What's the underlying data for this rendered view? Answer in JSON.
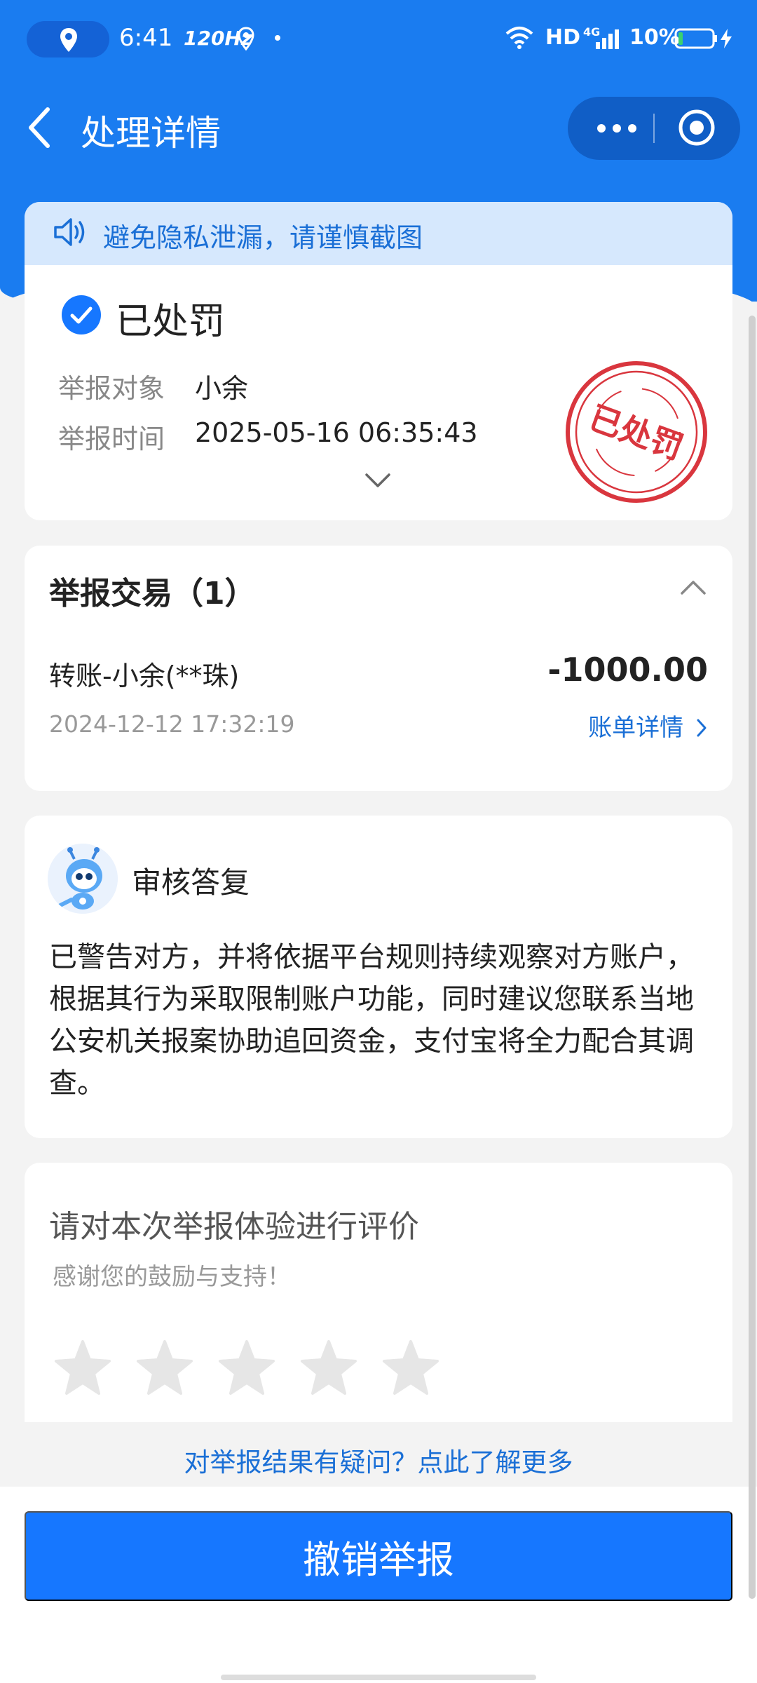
{
  "status_bar": {
    "time": "6:41",
    "refresh_rate": "120Hz",
    "hd": "HD",
    "network": "4G",
    "battery": "10%"
  },
  "nav": {
    "title": "处理详情"
  },
  "privacy_banner": {
    "text": "避免隐私泄漏，请谨慎截图"
  },
  "status": {
    "title": "已处罚",
    "target_label": "举报对象",
    "target_value": "小余",
    "time_label": "举报时间",
    "time_value": "2025-05-16 06:35:43",
    "stamp_text": "已处罚"
  },
  "transactions": {
    "title": "举报交易（1）",
    "items": [
      {
        "name": "转账-小余(**珠)",
        "amount": "-1000.00",
        "date": "2024-12-12 17:32:19",
        "link": "账单详情"
      }
    ]
  },
  "reply": {
    "title": "审核答复",
    "body": "已警告对方，并将依据平台规则持续观察对方账户，根据其行为采取限制账户功能，同时建议您联系当地公安机关报案协助追回资金，支付宝将全力配合其调查。"
  },
  "rating": {
    "title": "请对本次举报体验进行评价",
    "subtitle": "感谢您的鼓励与支持！",
    "stars_total": 5,
    "stars_selected": 0
  },
  "question_link": "对举报结果有疑问？点此了解更多",
  "revoke_button": "撤销举报",
  "colors": {
    "primary": "#1677ff",
    "header": "#1a7cf0",
    "link": "#1a6fd6",
    "stamp": "#d9363e"
  }
}
